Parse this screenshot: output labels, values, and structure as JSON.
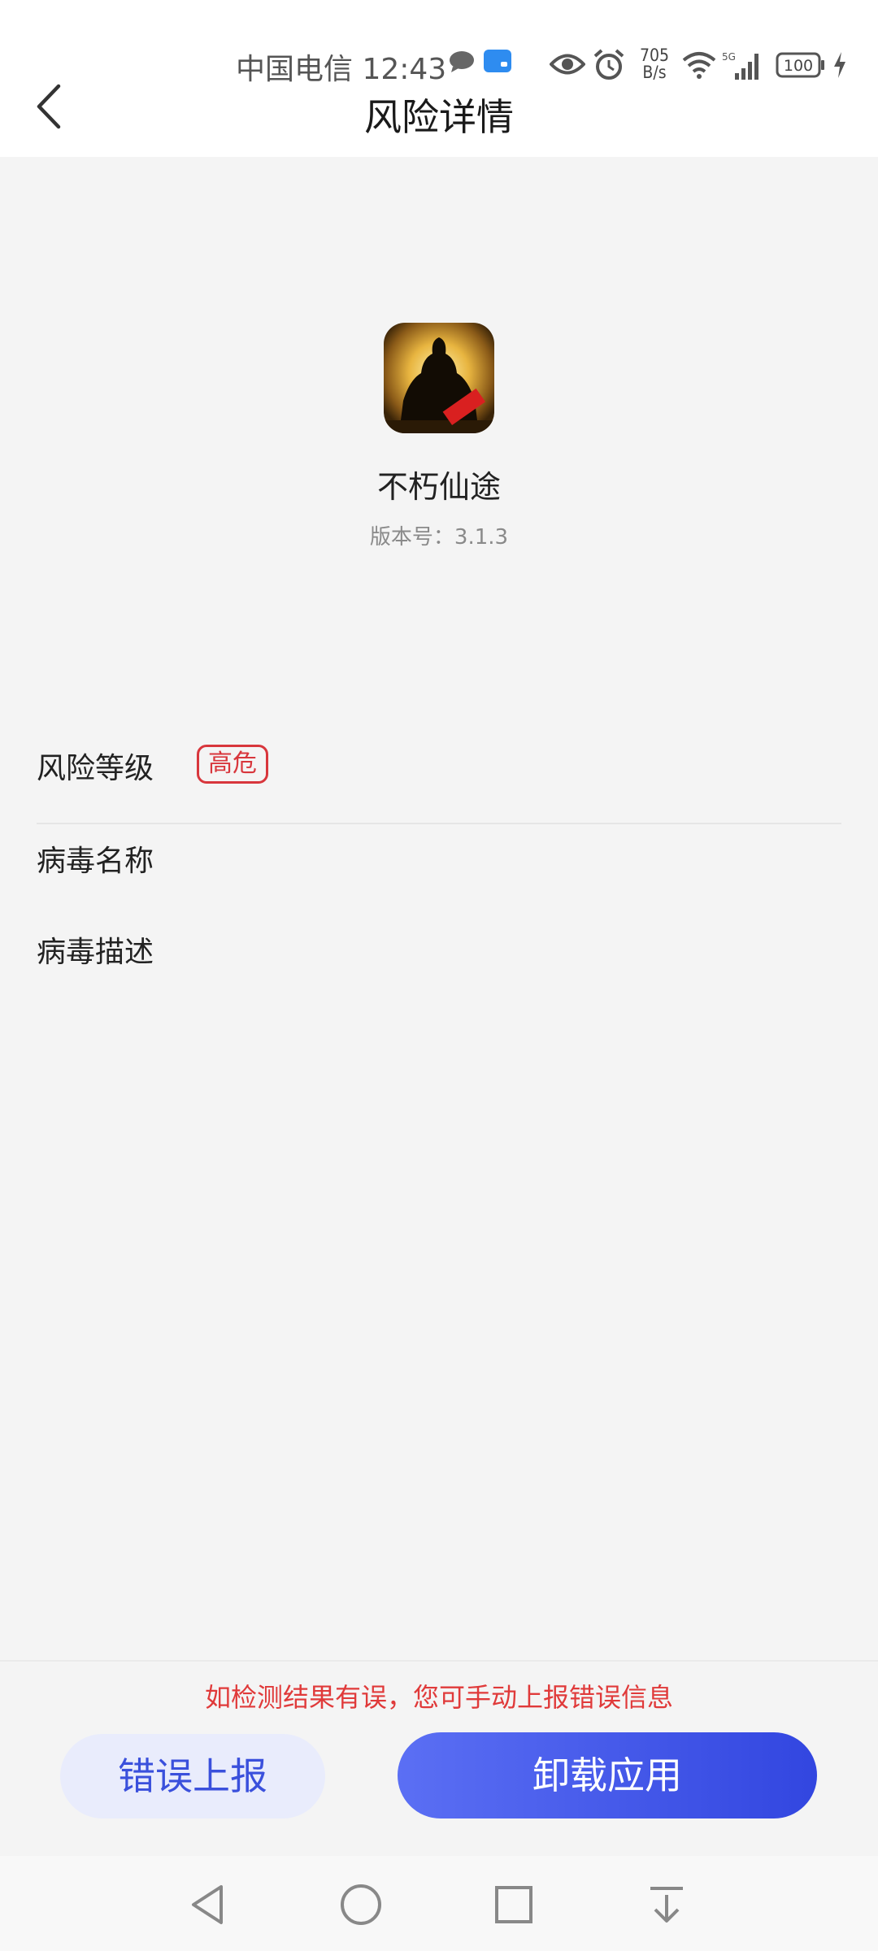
{
  "status_bar": {
    "carrier_time": "中国电信 12:43",
    "net_speed_value": "705",
    "net_speed_unit": "B/s",
    "network_type": "5G",
    "battery": "100",
    "icons": [
      "chat-bubble-icon",
      "app-notification-icon",
      "eye-icon",
      "alarm-icon",
      "wifi-icon",
      "signal-icon",
      "battery-icon",
      "charging-icon"
    ]
  },
  "header": {
    "title": "风险详情",
    "back_icon": "chevron-left-icon"
  },
  "app": {
    "name": "不朽仙途",
    "version": "版本号：3.1.3"
  },
  "details": {
    "risk_level_label": "风险等级",
    "risk_level_value": "高危",
    "virus_name_label": "病毒名称",
    "virus_desc_label": "病毒描述"
  },
  "footer": {
    "hint": "如检测结果有误，您可手动上报错误信息",
    "report_label": "错误上报",
    "uninstall_label": "卸载应用"
  },
  "nav": {
    "icons": [
      "back-triangle-icon",
      "home-circle-icon",
      "recents-square-icon",
      "pull-down-icon"
    ]
  },
  "colors": {
    "danger": "#d8363c",
    "primary": "#3a50dc",
    "background": "#f4f4f4"
  }
}
